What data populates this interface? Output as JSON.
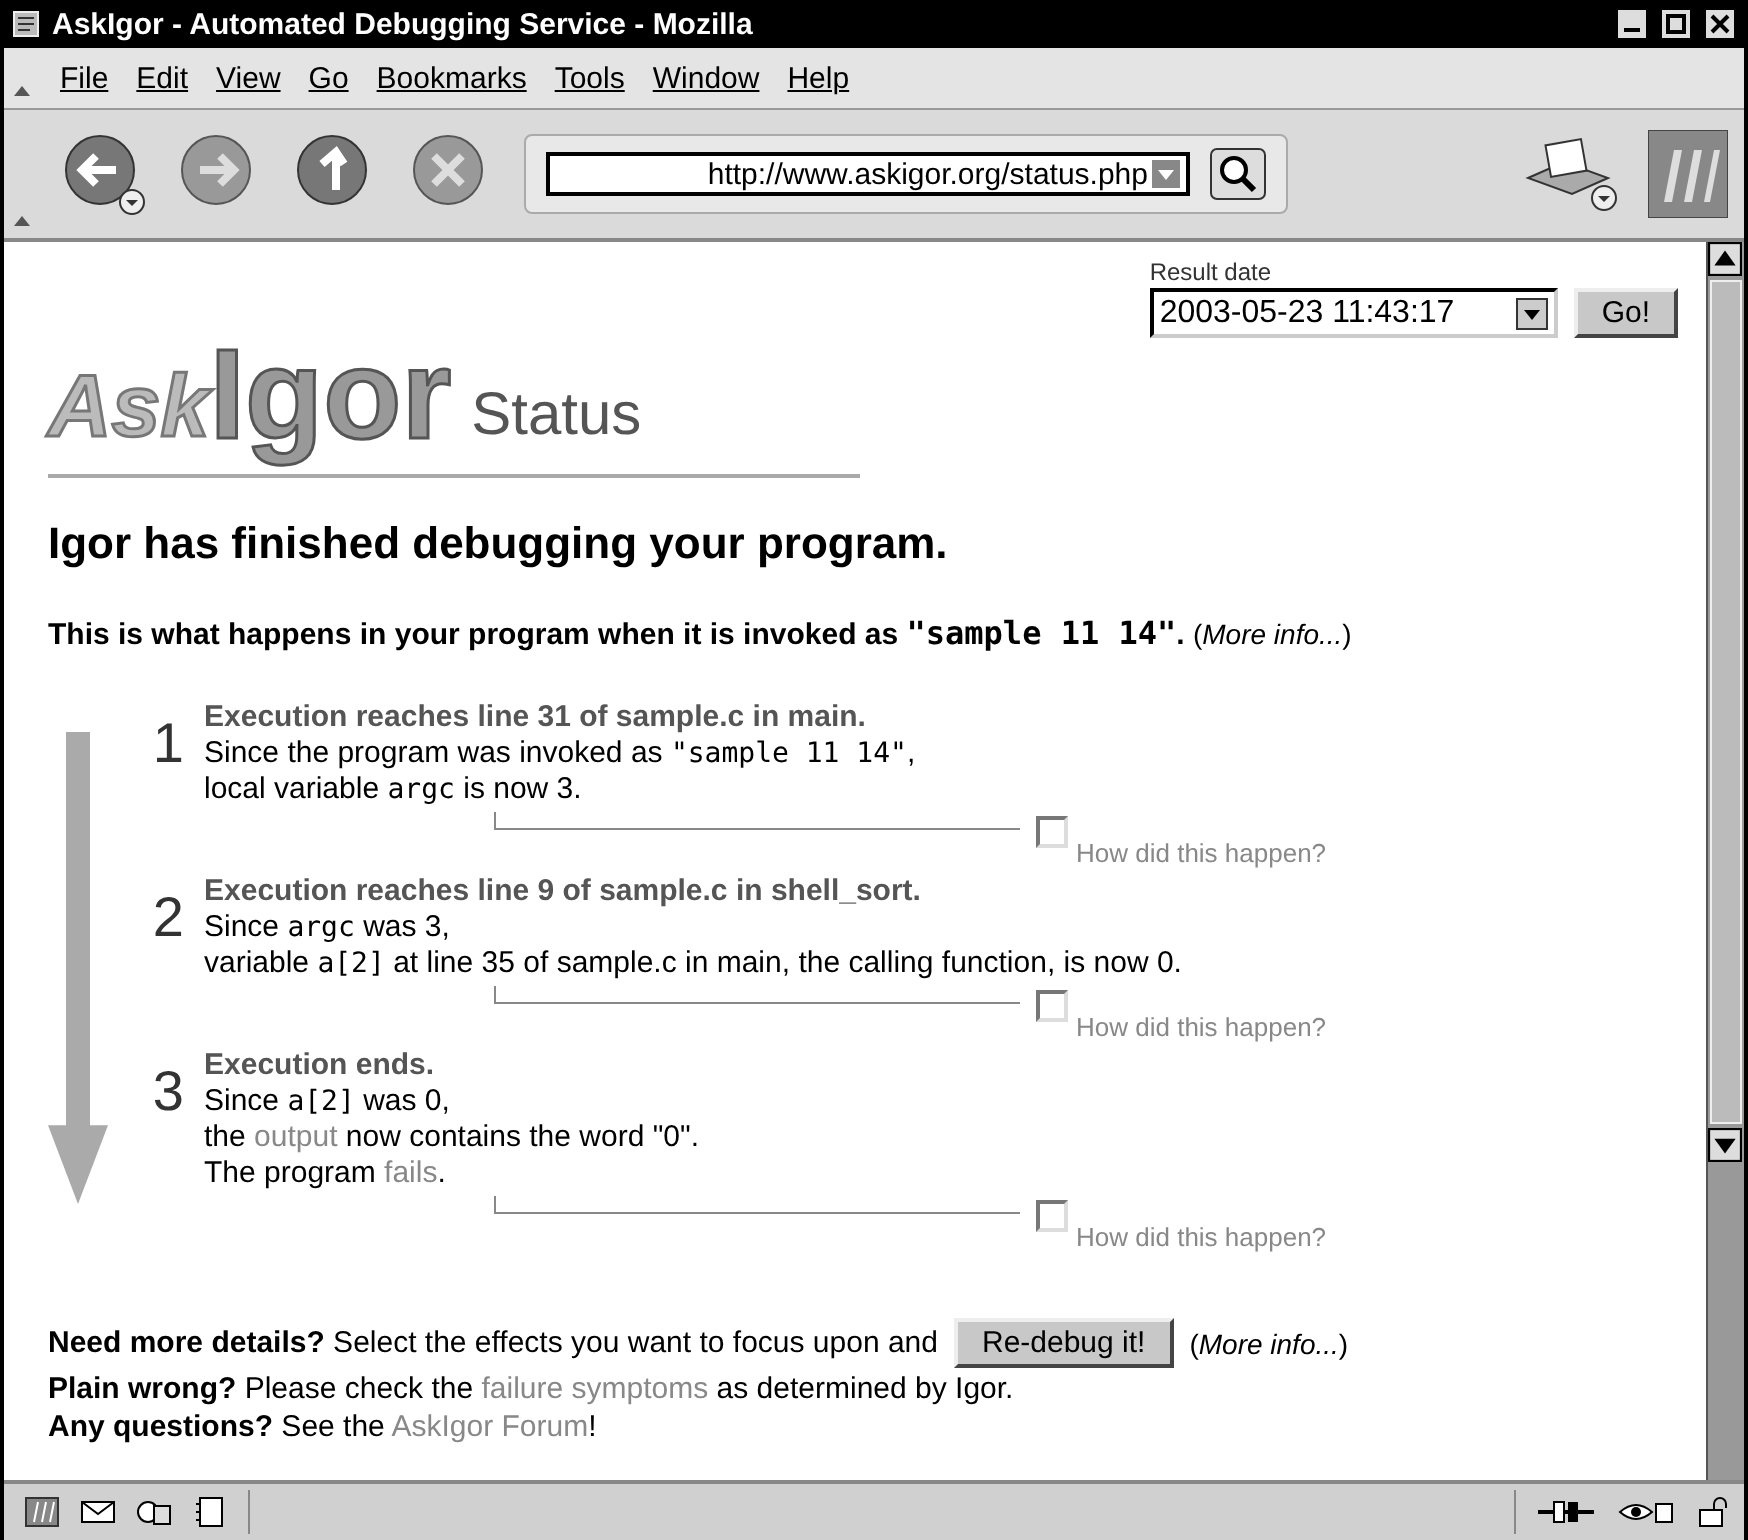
{
  "window": {
    "title": "AskIgor - Automated Debugging Service - Mozilla"
  },
  "menu": [
    "File",
    "Edit",
    "View",
    "Go",
    "Bookmarks",
    "Tools",
    "Window",
    "Help"
  ],
  "url": "http://www.askigor.org/status.php",
  "logo": {
    "ask": "Ask",
    "igor": "Igor",
    "status": "Status"
  },
  "result": {
    "label": "Result date",
    "value": "2003-05-23 11:43:17",
    "button": "Go!"
  },
  "heading": "Igor has finished debugging your program.",
  "intro": {
    "text": "This is what happens in your program when it is invoked as",
    "code": "\"sample 11 14\"",
    "end": ".",
    "more": "(*More info...*)"
  },
  "steps": [
    {
      "number": "1",
      "title": "Execution reaches line 31 of sample.c in main.",
      "lines": [
        [
          {
            "kind": "text",
            "text": "Since the program was invoked as "
          },
          {
            "kind": "code",
            "text": "\"sample 11 14\""
          },
          {
            "kind": "text",
            "text": ","
          }
        ],
        [
          {
            "kind": "text",
            "text": "local variable "
          },
          {
            "kind": "code",
            "text": "argc"
          },
          {
            "kind": "text",
            "text": " is now 3."
          }
        ]
      ],
      "checkbox": {
        "label": "How did this happen?",
        "checked": false
      }
    },
    {
      "number": "2",
      "title": "Execution reaches line 9 of sample.c in shell_sort.",
      "lines": [
        [
          {
            "kind": "text",
            "text": "Since "
          },
          {
            "kind": "code",
            "text": "argc"
          },
          {
            "kind": "text",
            "text": " was 3,"
          }
        ],
        [
          {
            "kind": "text",
            "text": "variable "
          },
          {
            "kind": "code",
            "text": "a[2]"
          },
          {
            "kind": "text",
            "text": " at line 35 of sample.c in main, the calling function, is now 0."
          }
        ]
      ],
      "checkbox": {
        "label": "How did this happen?",
        "checked": false
      }
    },
    {
      "number": "3",
      "title": "Execution ends.",
      "lines": [
        [
          {
            "kind": "text",
            "text": "Since "
          },
          {
            "kind": "code",
            "text": "a[2]"
          },
          {
            "kind": "text",
            "text": " was 0,"
          }
        ],
        [
          {
            "kind": "text",
            "text": "the "
          },
          {
            "kind": "link",
            "text": "output"
          },
          {
            "kind": "text",
            "text": " now contains the word \"0\"."
          }
        ],
        [
          {
            "kind": "text",
            "text": "The program "
          },
          {
            "kind": "link",
            "text": "fails"
          },
          {
            "kind": "text",
            "text": "."
          }
        ]
      ],
      "checkbox": {
        "label": "How did this happen?",
        "checked": false
      }
    }
  ],
  "footer": [
    [
      {
        "kind": "bold",
        "text": "Need more details?"
      },
      {
        "kind": "text",
        "text": " Select the effects you want to focus upon and"
      },
      {
        "kind": "button",
        "text": "Re-debug it!"
      },
      {
        "kind": "more",
        "text": "(*More info...*)"
      }
    ],
    [
      {
        "kind": "bold",
        "text": "Plain wrong?"
      },
      {
        "kind": "text",
        "text": " Please check the "
      },
      {
        "kind": "link",
        "text": "failure symptoms"
      },
      {
        "kind": "text",
        "text": " as determined by Igor."
      }
    ],
    [
      {
        "kind": "bold",
        "text": "Any questions?"
      },
      {
        "kind": "text",
        "text": " See the "
      },
      {
        "kind": "link",
        "text": "AskIgor Forum"
      },
      {
        "kind": "text",
        "text": "!"
      }
    ]
  ]
}
